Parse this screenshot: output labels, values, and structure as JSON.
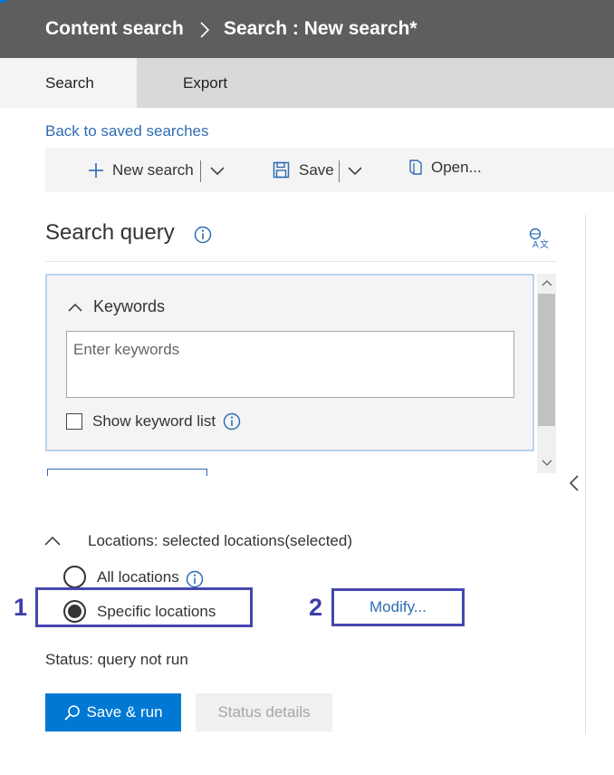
{
  "header": {
    "breadcrumb_root": "Content search",
    "breadcrumb_current": "Search : New search*"
  },
  "tabs": [
    {
      "label": "Search",
      "active": true
    },
    {
      "label": "Export",
      "active": false
    }
  ],
  "back_link": "Back to saved searches",
  "toolbar": {
    "new_search_label": "New search",
    "save_label": "Save",
    "open_label": "Open..."
  },
  "search_query": {
    "title": "Search query",
    "keywords_label": "Keywords",
    "keywords_placeholder": "Enter keywords",
    "keywords_value": "",
    "show_keyword_list_label": "Show keyword list",
    "show_keyword_list_checked": false
  },
  "locations": {
    "header_label": "Locations: selected locations(selected)",
    "options": [
      {
        "label": "All locations",
        "selected": false
      },
      {
        "label": "Specific locations",
        "selected": true
      }
    ],
    "modify_label": "Modify..."
  },
  "callouts": [
    "1",
    "2"
  ],
  "status": "Status: query not run",
  "buttons": {
    "save_run_label": "Save & run",
    "status_details_label": "Status details"
  },
  "colors": {
    "header_bg": "#5e5e5e",
    "accent_blue": "#0078d4",
    "link_blue": "#2f6db5",
    "callout_purple": "#4547b0"
  }
}
